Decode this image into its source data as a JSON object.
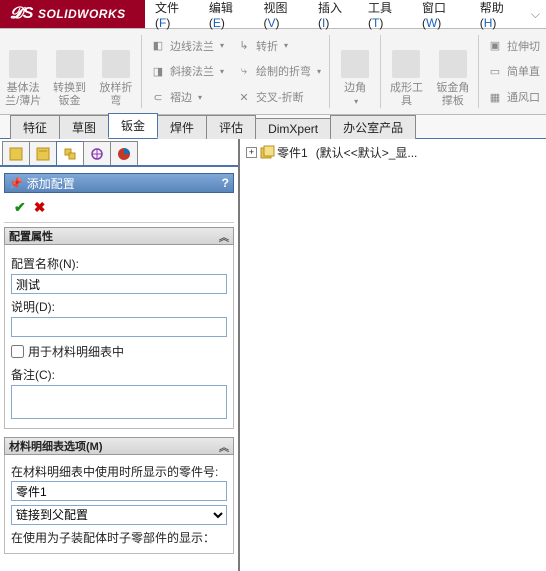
{
  "app": {
    "name": "SOLIDWORKS"
  },
  "menu": [
    {
      "label": "文件",
      "acc": "F"
    },
    {
      "label": "编辑",
      "acc": "E"
    },
    {
      "label": "视图",
      "acc": "V"
    },
    {
      "label": "插入",
      "acc": "I"
    },
    {
      "label": "工具",
      "acc": "T"
    },
    {
      "label": "窗口",
      "acc": "W"
    },
    {
      "label": "帮助",
      "acc": "H"
    }
  ],
  "ribbon": {
    "big": [
      {
        "lines": [
          "基体法",
          "兰/薄片"
        ]
      },
      {
        "lines": [
          "转换到",
          "钣金"
        ]
      },
      {
        "lines": [
          "放样折",
          "弯"
        ]
      }
    ],
    "col1": [
      "边线法兰",
      "斜接法兰",
      "褶边"
    ],
    "col2": [
      "转折",
      "绘制的折弯",
      "交叉-折断"
    ],
    "mid": [
      "边角"
    ],
    "big2": [
      {
        "lines": [
          "成形工",
          "具"
        ]
      },
      {
        "lines": [
          "钣金角",
          "撑板"
        ]
      }
    ],
    "col3": [
      "拉伸切",
      "简单直",
      "通风口"
    ]
  },
  "cmd_tabs": [
    "特征",
    "草图",
    "钣金",
    "焊件",
    "评估",
    "DimXpert",
    "办公室产品"
  ],
  "cmd_tabs_active": 2,
  "tree": {
    "node": "零件1",
    "suffix": "(默认<<默认>_显..."
  },
  "prop": {
    "title": "添加配置",
    "group1": {
      "title": "配置属性",
      "name_label": "配置名称(N):",
      "name_value": "测试",
      "desc_label": "说明(D):",
      "desc_value": "",
      "check_bom": "用于材料明细表中",
      "comment_label": "备注(C):",
      "comment_value": ""
    },
    "group2": {
      "title": "材料明细表选项(M)",
      "part_label": "在材料明细表中使用时所显示的零件号:",
      "part_value": "零件1",
      "link_value": "链接到父配置",
      "sub_label": "在使用为子装配体时子零部件的显示："
    }
  }
}
